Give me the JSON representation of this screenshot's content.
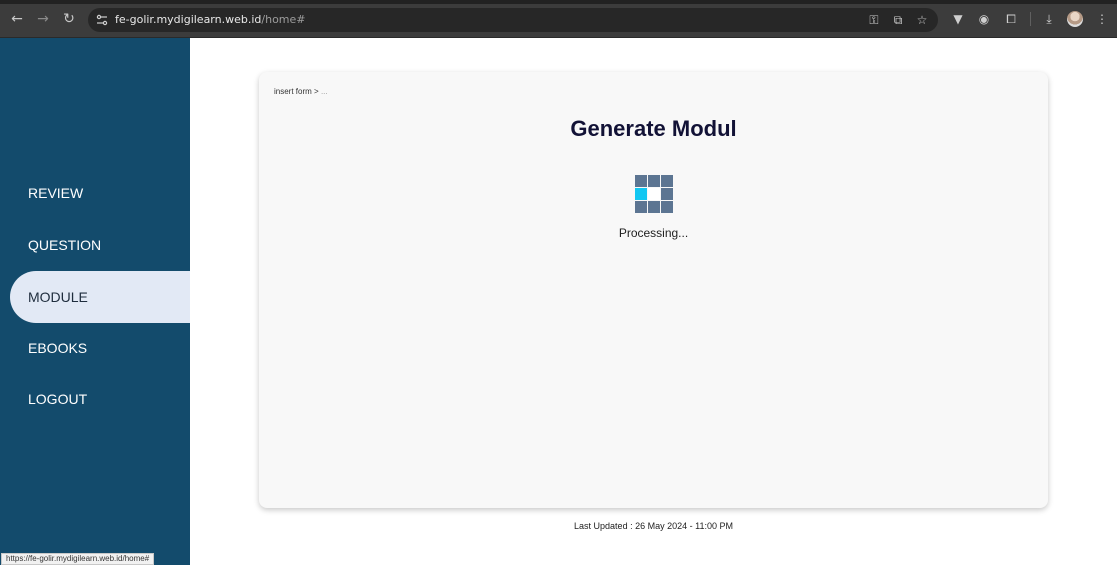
{
  "browser": {
    "url_host": "fe-golir.mydigilearn.web.id",
    "url_path": "/home#",
    "status_url": "https://fe-golir.mydigilearn.web.id/home#",
    "icons": [
      "back-icon",
      "forward-icon",
      "reload-icon",
      "site-settings-icon",
      "key-icon",
      "install-icon",
      "star-icon",
      "vivaldi-extension-icon",
      "camera-icon",
      "extensions-icon",
      "download-icon",
      "avatar",
      "menu-icon"
    ]
  },
  "sidebar": {
    "items": [
      {
        "label": "REVIEW",
        "active": false
      },
      {
        "label": "QUESTION",
        "active": false
      },
      {
        "label": "MODULE",
        "active": true
      },
      {
        "label": "EBOOKS",
        "active": false
      },
      {
        "label": "LOGOUT",
        "active": false
      }
    ],
    "bg_color": "#134b6c",
    "active_bg_color": "#e2e9f5"
  },
  "main": {
    "breadcrumb": {
      "current": "insert form",
      "separator": ">",
      "rest": "..."
    },
    "title": "Generate Modul",
    "status": "Processing...",
    "loader_highlight_color": "#12c7f2"
  },
  "footer": {
    "last_updated": "Last Updated : 26 May 2024 - 11:00 PM"
  }
}
